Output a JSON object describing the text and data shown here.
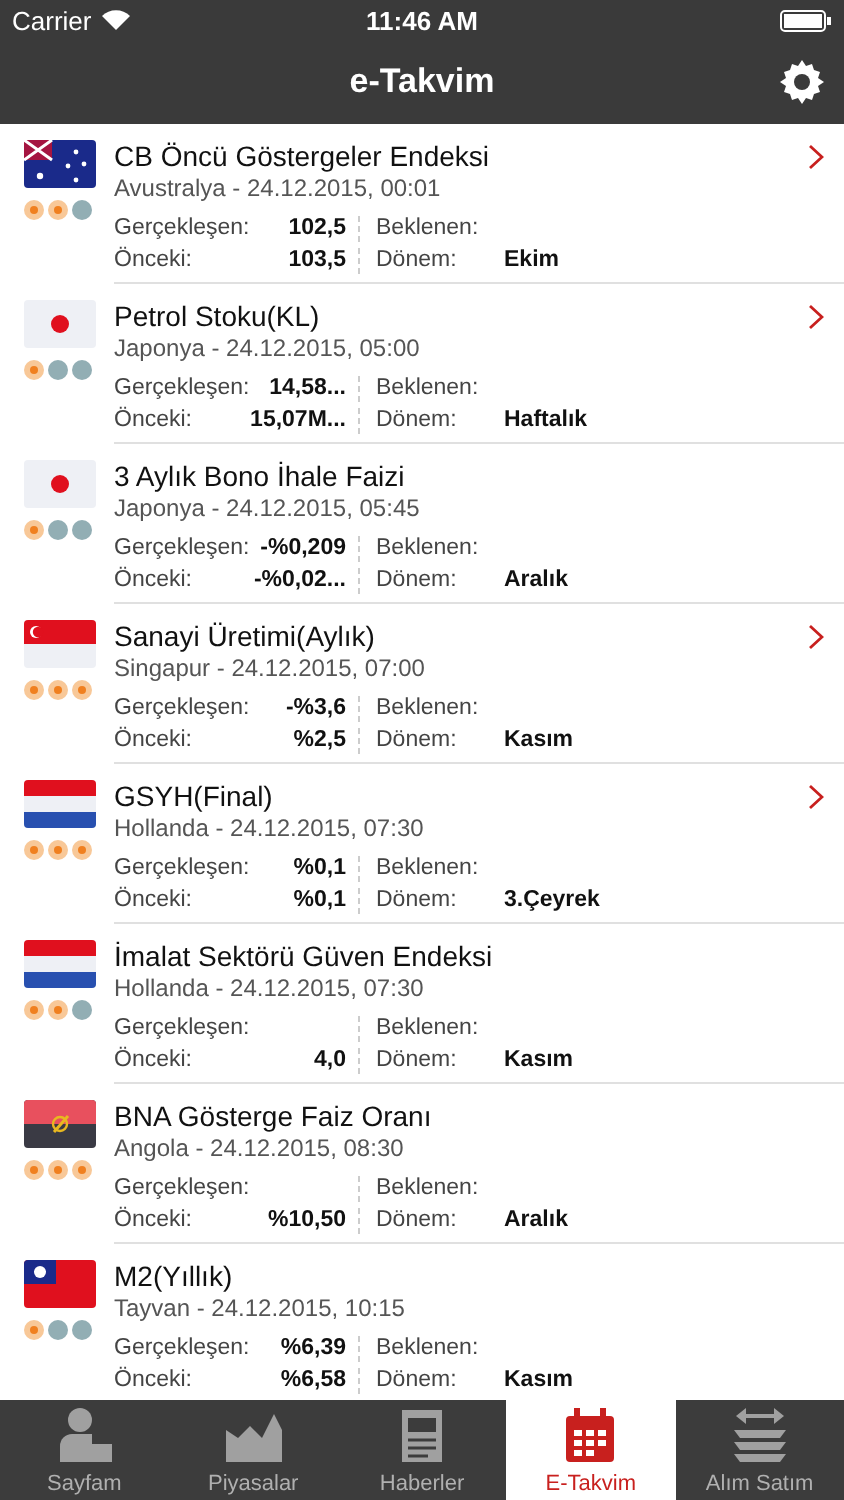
{
  "status_bar": {
    "carrier": "Carrier",
    "time": "11:46 AM"
  },
  "nav": {
    "title": "e-Takvim"
  },
  "events": [
    {
      "kind": "australia",
      "title": "CB Öncü Göstergeler Endeksi",
      "subtitle": "Avustralya - 24.12.2015, 00:01",
      "stars": 2,
      "has_detail": true,
      "fields": [
        {
          "label": "Gerçekleşen:",
          "value": "102,5"
        },
        {
          "label": "Beklenen:"
        },
        {
          "label": "Önceki:",
          "value": "103,5"
        },
        {
          "label": "Dönem:",
          "value": "Ekim"
        }
      ]
    },
    {
      "kind": "japan",
      "title": "Petrol Stoku(KL)",
      "subtitle": "Japonya - 24.12.2015, 05:00",
      "stars": 1,
      "has_detail": true,
      "fields": [
        {
          "label": "Gerçekleşen:",
          "value": "14,58..."
        },
        {
          "label": "Beklenen:"
        },
        {
          "label": "Önceki:",
          "value": "15,07M..."
        },
        {
          "label": "Dönem:",
          "value": "Haftalık"
        }
      ]
    },
    {
      "kind": "japan",
      "title": "3 Aylık Bono İhale Faizi",
      "subtitle": "Japonya - 24.12.2015, 05:45",
      "stars": 1,
      "has_detail": false,
      "fields": [
        {
          "label": "Gerçekleşen:",
          "value": "-%0,209"
        },
        {
          "label": "Beklenen:"
        },
        {
          "label": "Önceki:",
          "value": "-%0,02..."
        },
        {
          "label": "Dönem:",
          "value": "Aralık"
        }
      ]
    },
    {
      "kind": "singapore",
      "title": "Sanayi Üretimi(Aylık)",
      "subtitle": "Singapur - 24.12.2015, 07:00",
      "stars": 3,
      "has_detail": true,
      "fields": [
        {
          "label": "Gerçekleşen:",
          "value": "-%3,6"
        },
        {
          "label": "Beklenen:"
        },
        {
          "label": "Önceki:",
          "value": "%2,5"
        },
        {
          "label": "Dönem:",
          "value": "Kasım"
        }
      ]
    },
    {
      "kind": "netherlands",
      "title": "GSYH(Final)",
      "subtitle": "Hollanda - 24.12.2015, 07:30",
      "stars": 3,
      "has_detail": true,
      "fields": [
        {
          "label": "Gerçekleşen:",
          "value": "%0,1"
        },
        {
          "label": "Beklenen:"
        },
        {
          "label": "Önceki:",
          "value": "%0,1"
        },
        {
          "label": "Dönem:",
          "value": "3.Çeyrek"
        }
      ]
    },
    {
      "kind": "netherlands",
      "title": "İmalat Sektörü Güven Endeksi",
      "subtitle": "Hollanda - 24.12.2015, 07:30",
      "stars": 2,
      "has_detail": false,
      "fields": [
        {
          "label": "Gerçekleşen:"
        },
        {
          "label": "Beklenen:"
        },
        {
          "label": "Önceki:",
          "value": "4,0"
        },
        {
          "label": "Dönem:",
          "value": "Kasım"
        }
      ]
    },
    {
      "kind": "angola",
      "title": "BNA Gösterge Faiz Oranı",
      "subtitle": "Angola - 24.12.2015, 08:30",
      "stars": 3,
      "has_detail": false,
      "fields": [
        {
          "label": "Gerçekleşen:"
        },
        {
          "label": "Beklenen:"
        },
        {
          "label": "Önceki:",
          "value": "%10,50"
        },
        {
          "label": "Dönem:",
          "value": "Aralık"
        }
      ]
    },
    {
      "kind": "taiwan",
      "title": "M2(Yıllık)",
      "subtitle": "Tayvan - 24.12.2015, 10:15",
      "stars": 1,
      "has_detail": false,
      "fields": [
        {
          "label": "Gerçekleşen:",
          "value": "%6,39"
        },
        {
          "label": "Beklenen:"
        },
        {
          "label": "Önceki:",
          "value": "%6,58"
        },
        {
          "label": "Dönem:",
          "value": "Kasım"
        }
      ]
    }
  ],
  "tabs": [
    {
      "kind": "person",
      "label": "Sayfam",
      "selected": false
    },
    {
      "kind": "chart",
      "label": "Piyasalar",
      "selected": false
    },
    {
      "kind": "news",
      "label": "Haberler",
      "selected": false
    },
    {
      "kind": "calendar",
      "label": "E-Takvim",
      "selected": true
    },
    {
      "kind": "exchange",
      "label": "Alım Satım",
      "selected": false
    }
  ]
}
